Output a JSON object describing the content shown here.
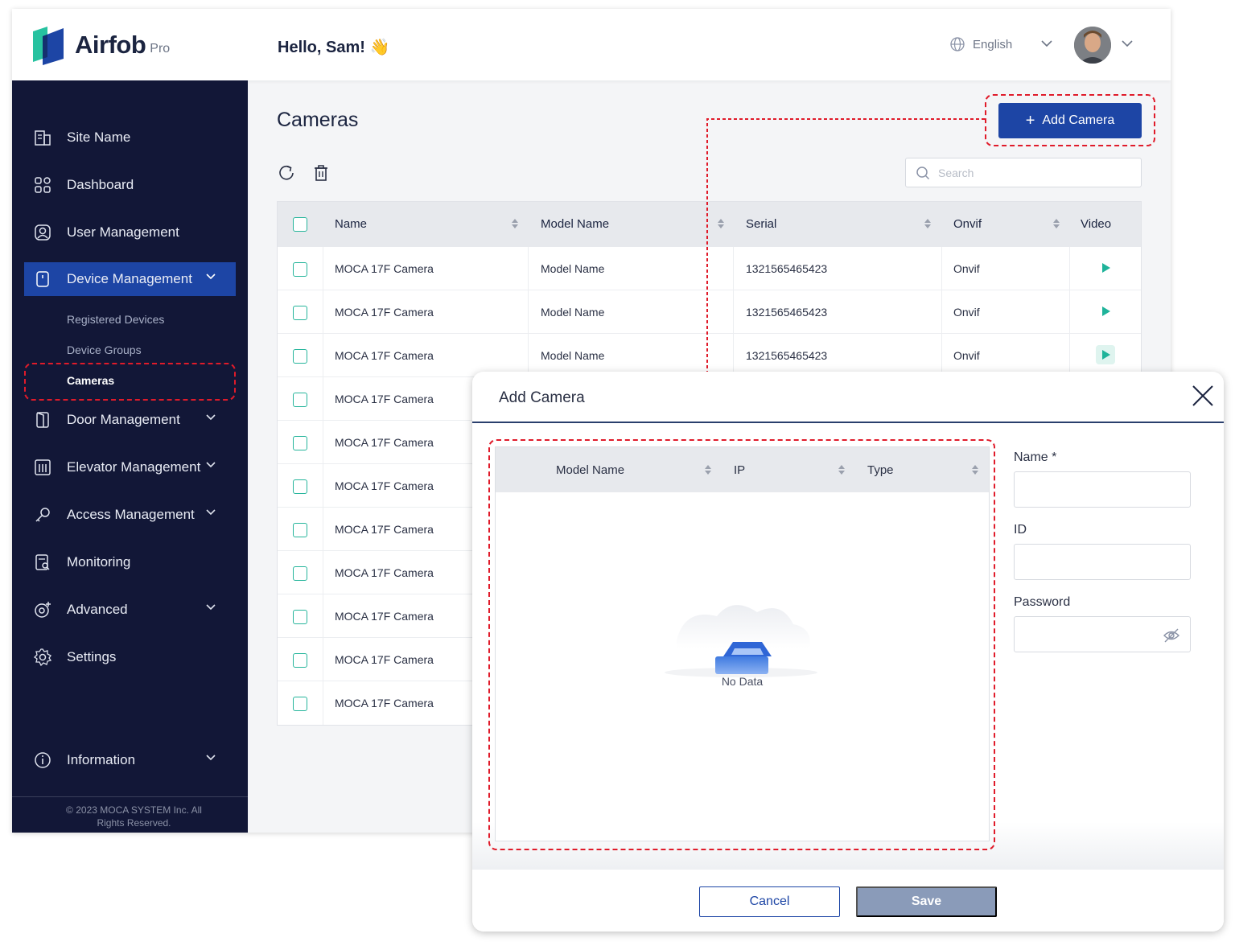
{
  "header": {
    "brand": "Airfob",
    "brand_suffix": "Pro",
    "greeting": "Hello, Sam! 👋",
    "language": "English"
  },
  "sidebar": {
    "items": [
      {
        "label": "Site Name",
        "icon": "building-icon"
      },
      {
        "label": "Dashboard",
        "icon": "dashboard-grid-icon"
      },
      {
        "label": "User Management",
        "icon": "user-icon"
      },
      {
        "label": "Device Management",
        "icon": "device-icon"
      },
      {
        "label": "Door Management",
        "icon": "door-icon"
      },
      {
        "label": "Elevator Management",
        "icon": "elevator-icon"
      },
      {
        "label": "Access Management",
        "icon": "key-icon"
      },
      {
        "label": "Monitoring",
        "icon": "monitoring-icon"
      },
      {
        "label": "Advanced",
        "icon": "advanced-icon"
      },
      {
        "label": "Settings",
        "icon": "gear-icon"
      },
      {
        "label": "Information",
        "icon": "info-icon"
      }
    ],
    "sub_items": [
      "Registered Devices",
      "Device Groups",
      "Cameras"
    ],
    "footer": "© 2023 MOCA SYSTEM Inc. All Rights Reserved."
  },
  "main": {
    "title": "Cameras",
    "add_button": "Add Camera",
    "search_placeholder": "Search",
    "columns": [
      "Name",
      "Model Name",
      "Serial",
      "Onvif",
      "Video"
    ],
    "rows": [
      {
        "name": "MOCA 17F Camera",
        "model": "Model Name",
        "serial": "1321565465423",
        "onvif": "Onvif"
      },
      {
        "name": "MOCA 17F Camera",
        "model": "Model Name",
        "serial": "1321565465423",
        "onvif": "Onvif"
      },
      {
        "name": "MOCA 17F Camera",
        "model": "Model Name",
        "serial": "1321565465423",
        "onvif": "Onvif"
      },
      {
        "name": "MOCA 17F Camera"
      },
      {
        "name": "MOCA 17F Camera"
      },
      {
        "name": "MOCA 17F Camera"
      },
      {
        "name": "MOCA 17F Camera"
      },
      {
        "name": "MOCA 17F Camera"
      },
      {
        "name": "MOCA 17F Camera"
      },
      {
        "name": "MOCA 17F Camera"
      },
      {
        "name": "MOCA 17F Camera"
      }
    ]
  },
  "modal": {
    "title": "Add Camera",
    "columns": [
      "Model Name",
      "IP",
      "Type"
    ],
    "empty_text": "No Data",
    "fields": {
      "name_label": "Name *",
      "id_label": "ID",
      "password_label": "Password"
    },
    "cancel": "Cancel",
    "save": "Save"
  },
  "colors": {
    "sidebar_bg": "#121737",
    "accent": "#1d45a5",
    "checkbox": "#26b59b",
    "highlight": "#e01b2a"
  }
}
